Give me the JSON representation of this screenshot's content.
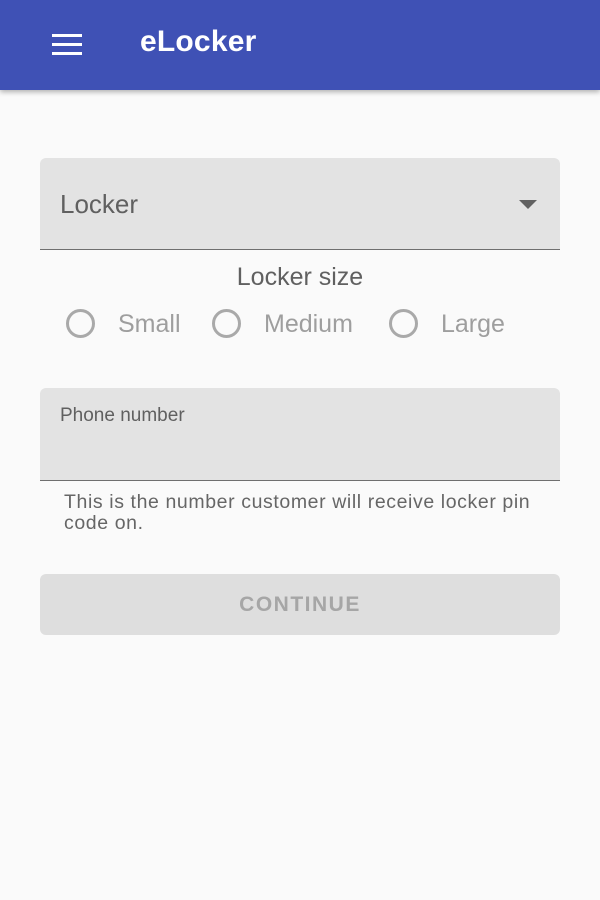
{
  "app_bar": {
    "menu_icon": "hamburger-menu-icon",
    "title": "eLocker",
    "background_color": "#3f51b5"
  },
  "form": {
    "locker_dropdown": {
      "value": "Locker",
      "arrow_icon": "dropdown-arrow-icon"
    },
    "locker_size": {
      "label": "Locker size",
      "options": [
        {
          "label": "Small",
          "selected": false
        },
        {
          "label": "Medium",
          "selected": false
        },
        {
          "label": "Large",
          "selected": false
        }
      ]
    },
    "phone": {
      "label": "Phone number",
      "value": "",
      "helper": "This is the number customer will receive locker pin code on."
    },
    "continue_button": {
      "label": "CONTINUE",
      "enabled": false
    }
  }
}
